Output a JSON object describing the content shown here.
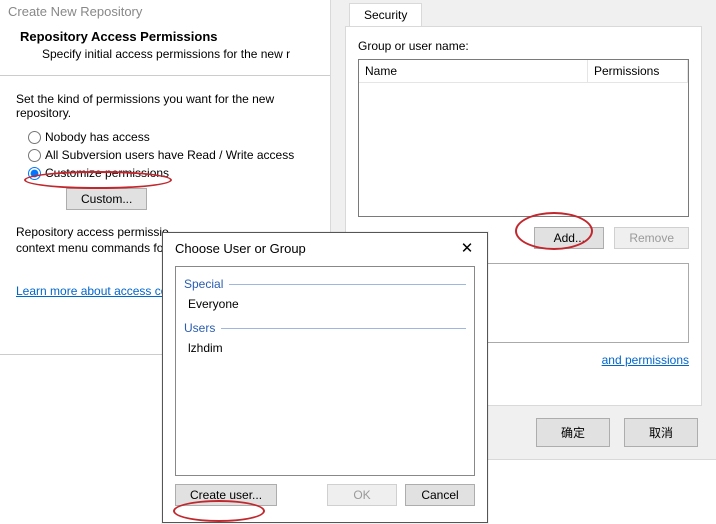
{
  "wizard": {
    "window_title": "Create New Repository",
    "heading": "Repository Access Permissions",
    "subheading": "Specify initial access permissions for the new r",
    "instruction": "Set the kind of permissions you want for the new repository.",
    "options": {
      "none": "Nobody has access",
      "all_rw": "All Subversion users have Read / Write access",
      "custom": "Customize permissions"
    },
    "custom_button": "Custom...",
    "description": "Repository access permissio\ncontext menu commands fo",
    "learn_link": "Learn more about access co"
  },
  "security": {
    "tab_label": "Security",
    "group_label": "Group or user name:",
    "columns": {
      "name": "Name",
      "permissions": "Permissions"
    },
    "add_button": "Add...",
    "remove_button": "Remove",
    "perm_link": "and permissions",
    "ok": "确定",
    "cancel": "取消"
  },
  "modal": {
    "title": "Choose User or Group",
    "sections": {
      "special": "Special",
      "users": "Users"
    },
    "entries": {
      "everyone": "Everyone",
      "user1": "lzhdim"
    },
    "create_user": "Create user...",
    "ok": "OK",
    "cancel": "Cancel"
  }
}
